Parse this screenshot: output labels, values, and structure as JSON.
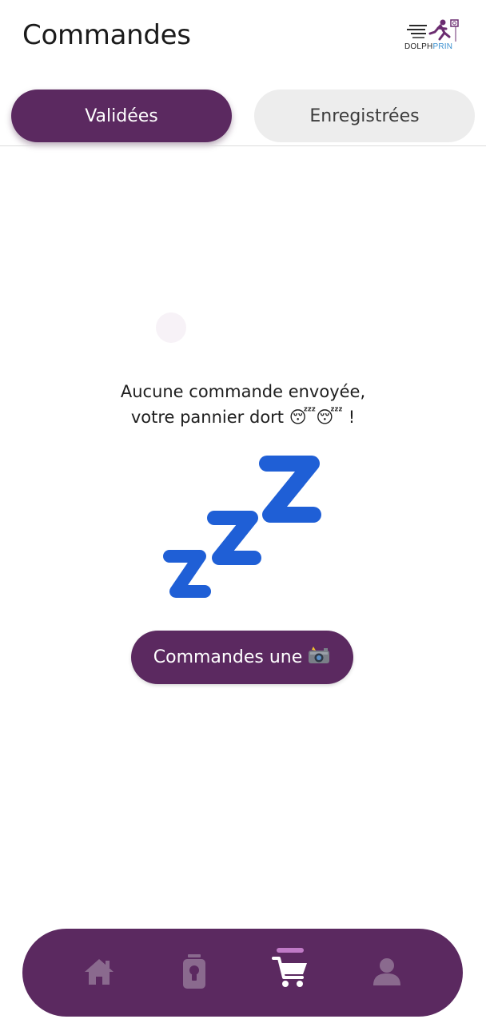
{
  "header": {
    "title": "Commandes",
    "logo": {
      "brand_part1": "DOLPH",
      "brand_part2": "PRIN",
      "icon": "running-person-logo"
    }
  },
  "tabs": [
    {
      "label": "Validées",
      "active": true
    },
    {
      "label": "Enregistrées",
      "active": false
    }
  ],
  "empty_state": {
    "line1": "Aucune commande envoyée,",
    "line2": "votre pannier dort 😴😴 !",
    "illustration": "zzz-sleeping-icon"
  },
  "cta": {
    "label": "Commandes une",
    "icon": "camera-flash-emoji"
  },
  "bottom_nav": {
    "items": [
      {
        "name": "home",
        "icon": "home-icon",
        "active": false
      },
      {
        "name": "products",
        "icon": "lamp-icon",
        "active": false
      },
      {
        "name": "cart",
        "icon": "cart-icon",
        "active": true
      },
      {
        "name": "profile",
        "icon": "profile-icon",
        "active": false
      }
    ]
  },
  "colors": {
    "primary": "#5b2960",
    "tab_inactive_bg": "#ededed",
    "nav_icon_inactive": "#8a6a8e",
    "nav_icon_active": "#ffffff",
    "nav_indicator": "#c07ac6",
    "zzz_blue": "#1f5fd6"
  }
}
